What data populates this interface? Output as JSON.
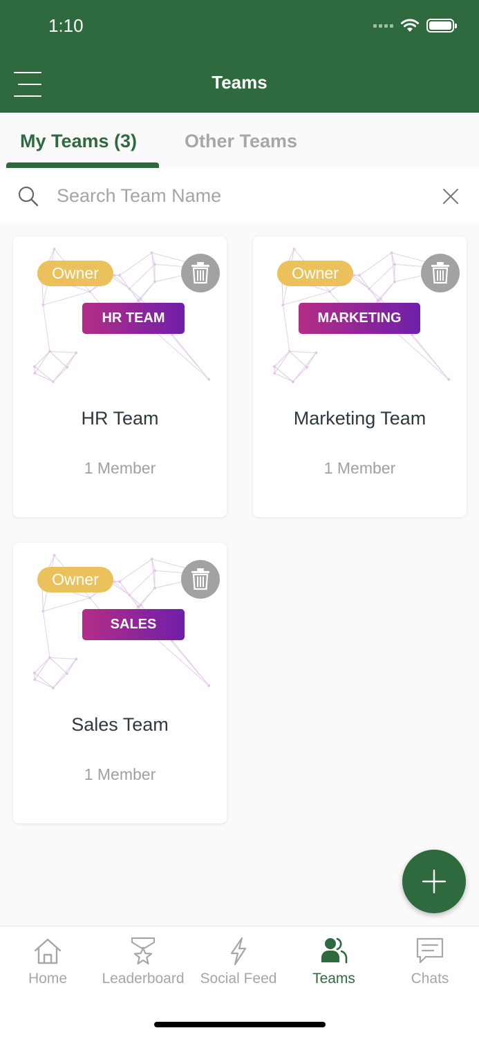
{
  "status_bar": {
    "time": "1:10"
  },
  "header": {
    "title": "Teams",
    "menu_icon": "hamburger-menu-icon"
  },
  "tabs": [
    {
      "label": "My Teams (3)",
      "active": true
    },
    {
      "label": "Other Teams",
      "active": false
    }
  ],
  "search": {
    "placeholder": "Search Team Name",
    "value": ""
  },
  "teams": [
    {
      "badge": "Owner",
      "tag": "HR TEAM",
      "name": "HR Team",
      "members": "1 Member"
    },
    {
      "badge": "Owner",
      "tag": "MARKETING",
      "name": "Marketing Team",
      "members": "1 Member"
    },
    {
      "badge": "Owner",
      "tag": "SALES",
      "name": "Sales Team",
      "members": "1 Member"
    }
  ],
  "nav": [
    {
      "label": "Home",
      "icon": "home-icon",
      "active": false
    },
    {
      "label": "Leaderboard",
      "icon": "trophy-star-icon",
      "active": false
    },
    {
      "label": "Social Feed",
      "icon": "lightning-icon",
      "active": false
    },
    {
      "label": "Teams",
      "icon": "people-icon",
      "active": true
    },
    {
      "label": "Chats",
      "icon": "chat-bubble-icon",
      "active": false
    }
  ],
  "colors": {
    "primary": "#2e6a3e",
    "owner_badge": "#eac15a",
    "tag_gradient_start": "#b42d86",
    "tag_gradient_end": "#6f1faa",
    "inactive": "#a6a6a6"
  }
}
